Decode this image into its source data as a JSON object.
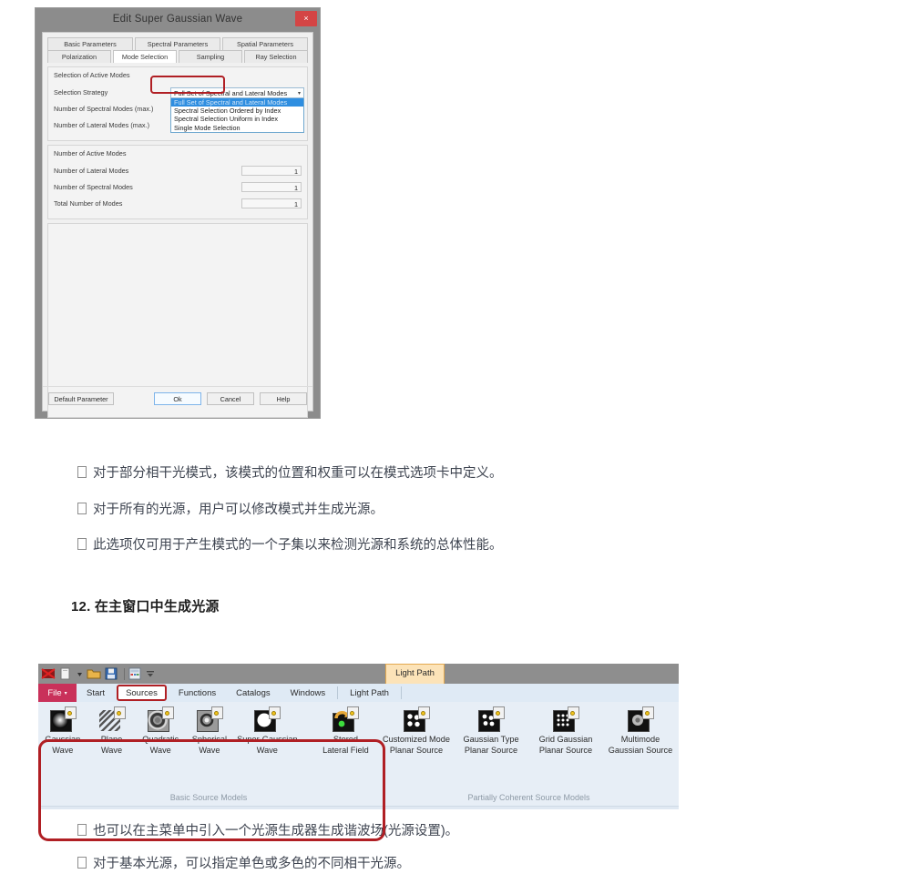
{
  "dialog": {
    "title": "Edit Super Gaussian Wave",
    "close_label": "×",
    "tabs_row1": [
      "Basic Parameters",
      "Spectral Parameters",
      "Spatial Parameters"
    ],
    "tabs_row2": [
      "Polarization",
      "Mode Selection",
      "Sampling",
      "Ray Selection"
    ],
    "active_tab": "Mode Selection",
    "panel1": {
      "title": "Selection of Active Modes",
      "fields": [
        {
          "label": "Selection Strategy",
          "value": ""
        },
        {
          "label": "Number of Spectral Modes (max.)",
          "value": ""
        },
        {
          "label": "Number of Lateral Modes (max.)",
          "value": ""
        }
      ],
      "combo": {
        "selected": "Full Set of Spectral and Lateral Modes",
        "caret": "▾",
        "options": [
          "Full Set of Spectral and Lateral Modes",
          "Spectral Selection Ordered by Index",
          "Spectral Selection Uniform in Index",
          "Single Mode Selection"
        ]
      }
    },
    "panel2": {
      "title": "Number of Active Modes",
      "fields": [
        {
          "label": "Number of Lateral Modes",
          "value": "1"
        },
        {
          "label": "Number of Spectral Modes",
          "value": "1"
        },
        {
          "label": "Total Number of Modes",
          "value": "1"
        }
      ]
    },
    "buttons": {
      "default_parameter": "Default Parameter",
      "ok": "Ok",
      "cancel": "Cancel",
      "help": "Help"
    }
  },
  "document": {
    "bullets_top": [
      "对于部分相干光模式，该模式的位置和权重可以在模式选项卡中定义。",
      "对于所有的光源，用户可以修改模式并生成光源。",
      "此选项仅可用于产生模式的一个子集以来检测光源和系统的总体性能。"
    ],
    "heading": "12. 在主窗口中生成光源",
    "bullets_bottom": [
      "也可以在主菜单中引入一个光源生成器生成谐波场(光源设置)。",
      "对于基本光源，可以指定单色或多色的不同相干光源。"
    ]
  },
  "ribbon": {
    "quick_access_icons": [
      "app-logo-icon",
      "new-document-icon",
      "dropdown-arrow-icon",
      "open-folder-icon",
      "save-disk-icon",
      "calculator-icon",
      "customize-qat-icon"
    ],
    "context_tab_top": "Light Path",
    "file_tab": "File",
    "file_tab_caret": "▾",
    "tabs": [
      "Start",
      "Sources",
      "Functions",
      "Catalogs",
      "Windows",
      "Light Path"
    ],
    "active_tab": "Sources",
    "groups": [
      {
        "title": "Basic Source Models",
        "items": [
          {
            "line1": "Gaussian",
            "line2": "Wave",
            "icon": "gaussian-wave-icon"
          },
          {
            "line1": "Plane",
            "line2": "Wave",
            "icon": "plane-wave-icon"
          },
          {
            "line1": "Quadratic",
            "line2": "Wave",
            "icon": "quadratic-wave-icon"
          },
          {
            "line1": "Spherical",
            "line2": "Wave",
            "icon": "spherical-wave-icon"
          },
          {
            "line1": "Super-Gaussian",
            "line2": "Wave",
            "icon": "super-gaussian-wave-icon"
          },
          {
            "line1": "Stored",
            "line2": "Lateral Field",
            "icon": "stored-lateral-field-icon"
          }
        ]
      },
      {
        "title": "Partially Coherent Source Models",
        "items": [
          {
            "line1": "Customized Mode",
            "line2": "Planar Source",
            "icon": "customized-mode-planar-source-icon"
          },
          {
            "line1": "Gaussian Type",
            "line2": "Planar Source",
            "icon": "gaussian-type-planar-source-icon"
          },
          {
            "line1": "Grid Gaussian",
            "line2": "Planar Source",
            "icon": "grid-gaussian-planar-source-icon"
          },
          {
            "line1": "Multimode",
            "line2": "Gaussian Source",
            "icon": "multimode-gaussian-source-icon"
          }
        ]
      }
    ]
  },
  "colors": {
    "highlight_red": "#b01f24",
    "file_tab_pink": "#c9315a",
    "context_tab_orange": "#fce3b8",
    "close_button_red": "#d44545",
    "combo_selected_blue": "#2f8ee0"
  }
}
